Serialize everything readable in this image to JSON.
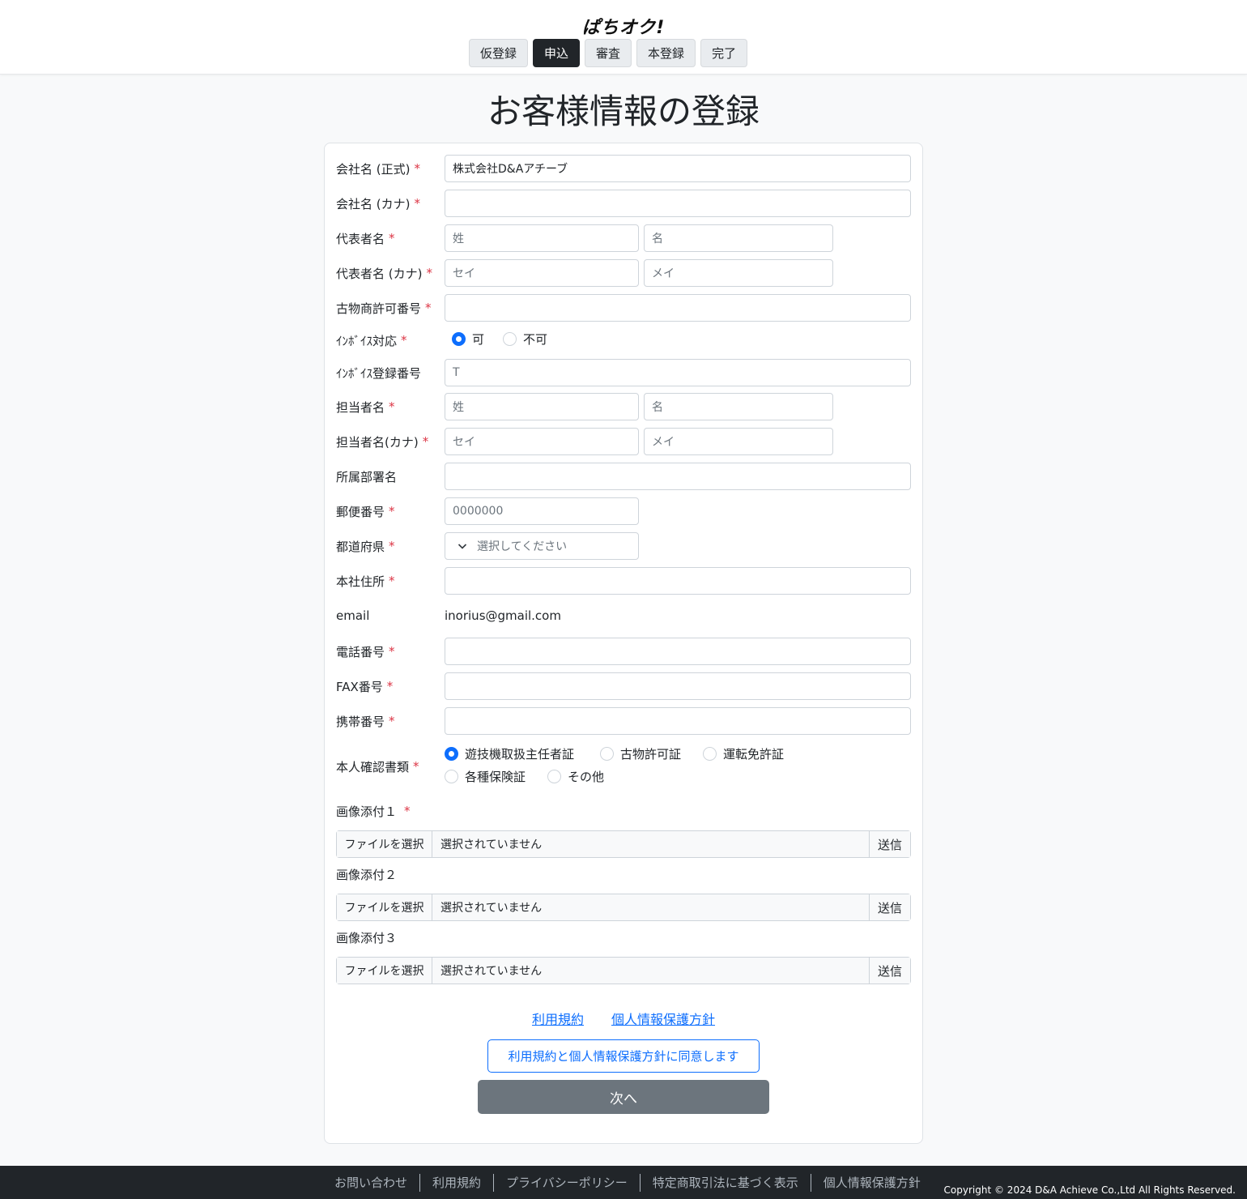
{
  "header": {
    "logo": "ぱちオク!",
    "steps": [
      "仮登録",
      "申込",
      "審査",
      "本登録",
      "完了"
    ]
  },
  "page_title": "お客様情報の登録",
  "form": {
    "required_mark": "*",
    "company_name": {
      "label": "会社名 (正式)",
      "value": "株式会社D&Aアチーブ"
    },
    "company_kana": {
      "label": "会社名 (カナ)",
      "value": ""
    },
    "rep_name": {
      "label": "代表者名",
      "last_ph": "姓",
      "first_ph": "名"
    },
    "rep_kana": {
      "label": "代表者名 (カナ)",
      "last_ph": "セイ",
      "first_ph": "メイ"
    },
    "antique_license": {
      "label": "古物商許可番号",
      "value": ""
    },
    "invoice": {
      "label": "ｲﾝﾎﾞｲｽ対応",
      "options": [
        "可",
        "不可"
      ],
      "selected": "可"
    },
    "invoice_no": {
      "label": "ｲﾝﾎﾞｲｽ登録番号",
      "value": "T"
    },
    "contact_name": {
      "label": "担当者名",
      "last_ph": "姓",
      "first_ph": "名"
    },
    "contact_kana": {
      "label": "担当者名(カナ)",
      "last_ph": "セイ",
      "first_ph": "メイ"
    },
    "department": {
      "label": "所属部署名",
      "value": ""
    },
    "postal": {
      "label": "郵便番号",
      "placeholder": "0000000"
    },
    "prefecture": {
      "label": "都道府県",
      "selected": "選択してください"
    },
    "address": {
      "label": "本社住所",
      "value": ""
    },
    "email": {
      "label": "email",
      "value": "inorius@gmail.com"
    },
    "phone": {
      "label": "電話番号",
      "value": ""
    },
    "fax": {
      "label": "FAX番号",
      "value": ""
    },
    "mobile": {
      "label": "携帯番号",
      "value": ""
    },
    "id_doc": {
      "label": "本人確認書類",
      "options": [
        "遊技機取扱主任者証",
        "古物許可証",
        "運転免許証",
        "各種保険証",
        "その他"
      ],
      "selected": "遊技機取扱主任者証"
    },
    "attachments": [
      {
        "label": "画像添付１",
        "required": true,
        "button": "ファイルを選択",
        "status": "選択されていません",
        "send": "送信"
      },
      {
        "label": "画像添付２",
        "required": false,
        "button": "ファイルを選択",
        "status": "選択されていません",
        "send": "送信"
      },
      {
        "label": "画像添付３",
        "required": false,
        "button": "ファイルを選択",
        "status": "選択されていません",
        "send": "送信"
      }
    ],
    "links": [
      "利用規約",
      "個人情報保護方針"
    ],
    "agree_button": "利用規約と個人情報保護方針に同意します",
    "next_button": "次へ"
  },
  "footer": {
    "links": [
      "お問い合わせ",
      "利用規約",
      "プライバシーポリシー",
      "特定商取引法に基づく表示",
      "個人情報保護方針"
    ],
    "copyright": "Copyright © 2024 D&A Achieve Co.,Ltd All Rights Reserved."
  },
  "colors": {
    "primary": "#0d6efd",
    "required": "#dc3545",
    "dark": "#212529",
    "secondary": "#6c757d"
  }
}
